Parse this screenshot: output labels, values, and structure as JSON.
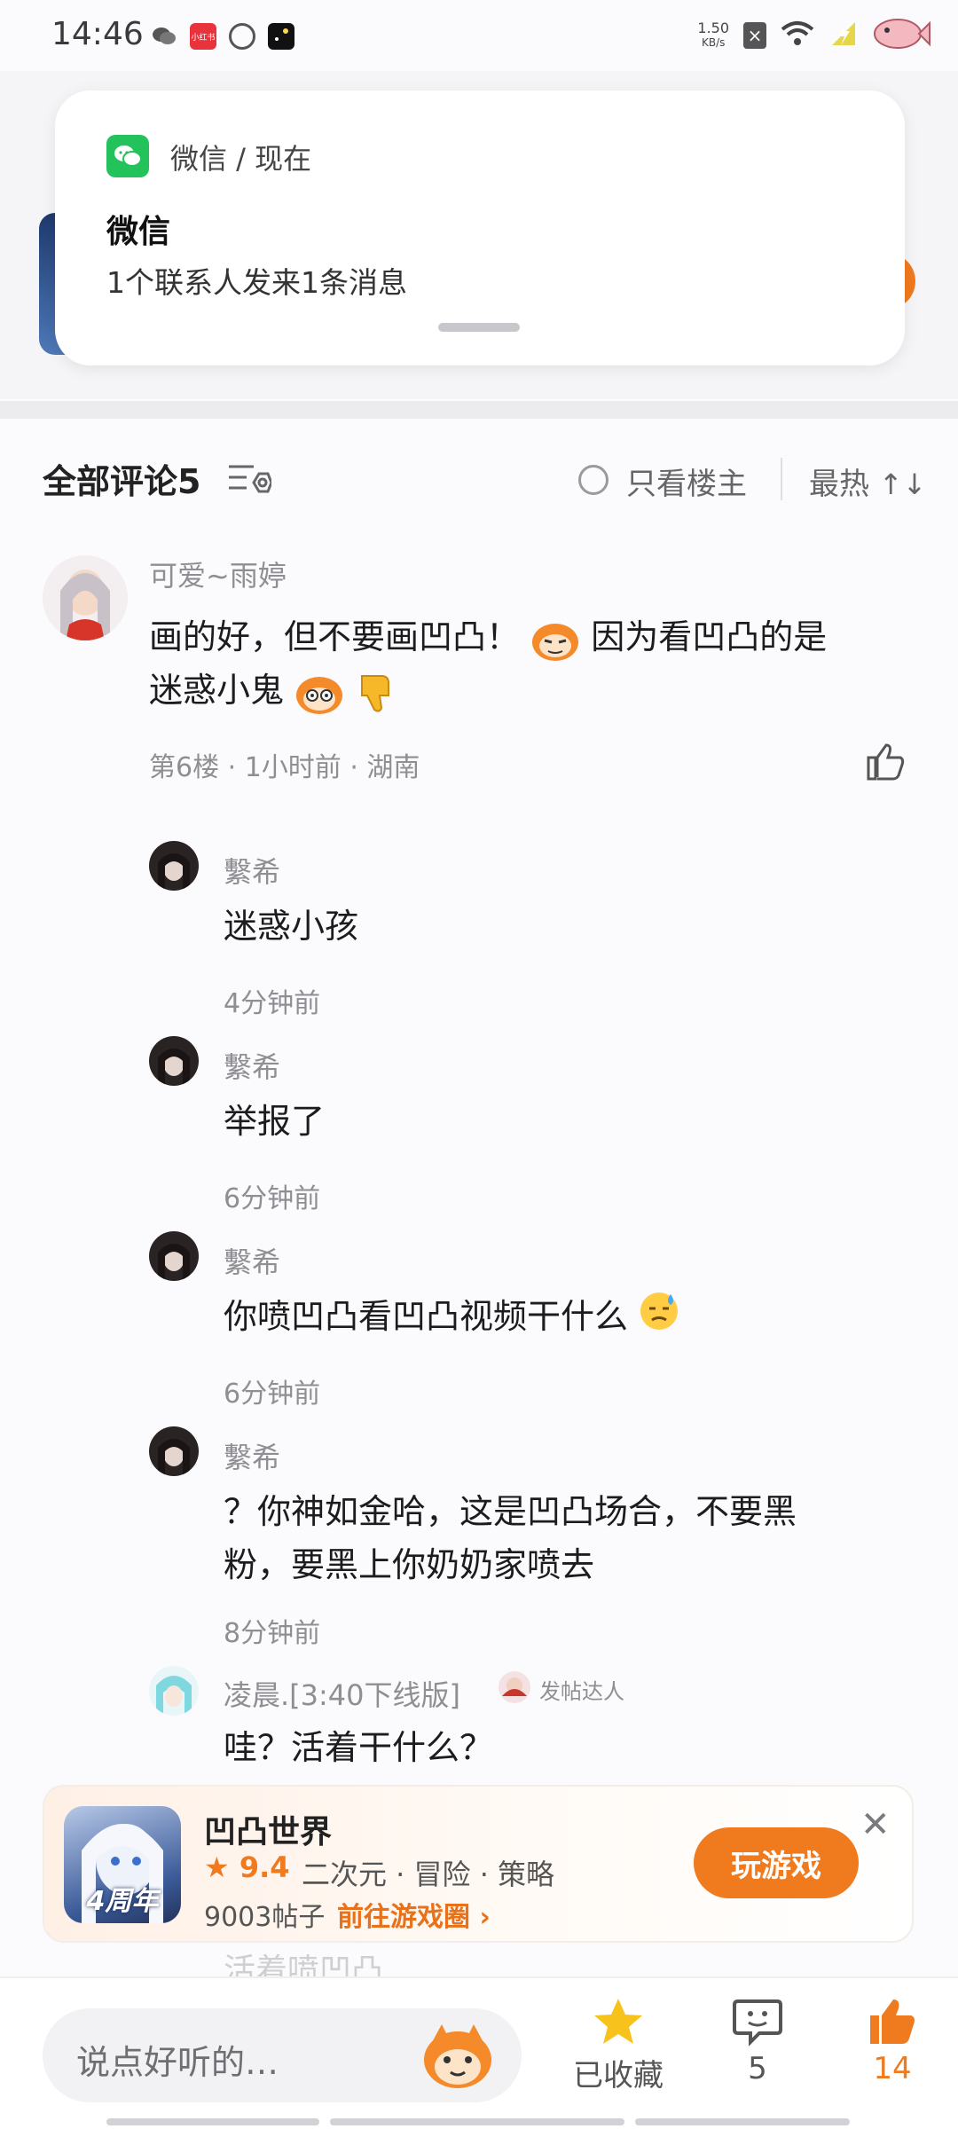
{
  "status_bar": {
    "time": "14:46",
    "net_speed": "1.50",
    "net_unit": "KB/s",
    "app_badge": "小红书"
  },
  "notification": {
    "source": "微信 / 现在",
    "title": "微信",
    "body": "1个联系人发来1条消息"
  },
  "comments_header": {
    "title": "全部评论5",
    "only_op_label": "只看楼主",
    "sort_label": "最热"
  },
  "main_comment": {
    "username": "可爱~雨婷",
    "text_line1": "画的好，但不要画凹凸！",
    "text_line1b": "因为看凹凸的是",
    "text_line2": "迷惑小鬼",
    "meta": "第6楼 · 1小时前 · 湖南"
  },
  "replies": [
    {
      "username": "繫希",
      "text": "迷惑小孩",
      "time": "4分钟前"
    },
    {
      "username": "繫希",
      "text": "举报了",
      "time": "6分钟前"
    },
    {
      "username": "繫希",
      "text": "你喷凹凸看凹凸视频干什么",
      "time": "6分钟前"
    },
    {
      "username": "繫希",
      "text_line1": "？你神如金哈，这是凹凸场合，不要黑",
      "text_line2": "粉，要黑上你奶奶家喷去",
      "time": "8分钟前"
    },
    {
      "username": "凌晨.[3:40下线版]",
      "badge": "发帖达人",
      "text": "哇？活着干什么？"
    }
  ],
  "game_card": {
    "icon_label": "4周年",
    "name": "凹凸世界",
    "rating": "9.4",
    "tags": "二次元 · 冒险 · 策略",
    "posts": "9003帖子",
    "goto": "前往游戏圈",
    "play_label": "玩游戏"
  },
  "faded_text": "活着喷凹凸",
  "bottom_bar": {
    "input_placeholder": "说点好听的…",
    "favorite_label": "已收藏",
    "comment_count": "5",
    "like_count": "14",
    "accent_color": "#f07a1e"
  }
}
